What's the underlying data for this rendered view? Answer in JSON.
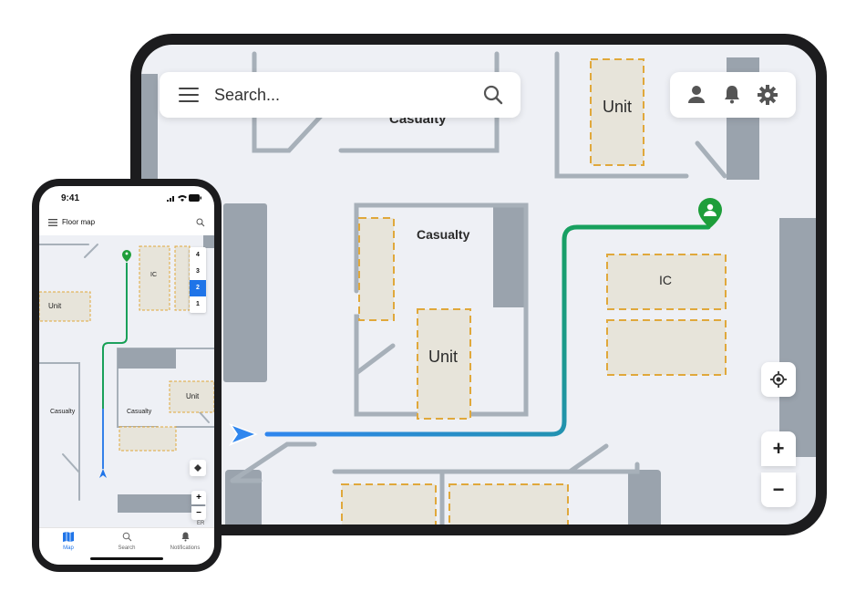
{
  "tablet": {
    "search": {
      "placeholder": "Search..."
    },
    "rooms": {
      "unit_top": "Unit",
      "casualty_top": "Casualty",
      "casualty_center": "Casualty",
      "unit_center": "Unit",
      "ic": "IC"
    },
    "icons": {
      "menu": "hamburger-menu-icon",
      "search": "search-icon",
      "profile": "user-icon",
      "notifications": "bell-icon",
      "settings": "gear-icon",
      "locate": "locate-icon",
      "position": "navigation-arrow-icon",
      "destination": "location-pin-icon"
    },
    "zoom": {
      "in_label": "+",
      "out_label": "−"
    },
    "colors": {
      "route_start": "#2f86ee",
      "route_end": "#16a34a",
      "room_border": "#e0a83b",
      "wall": "#9aa3ad",
      "pin": "#1e9e3a"
    }
  },
  "phone": {
    "status": {
      "time": "9:41"
    },
    "appbar": {
      "title": "Floor map"
    },
    "floors": [
      "4",
      "3",
      "2",
      "1"
    ],
    "active_floor": "2",
    "rooms": {
      "ic": "IC",
      "unit_left": "Unit",
      "casualty_left": "Casualty",
      "casualty_center": "Casualty",
      "unit_right": "Unit",
      "er": "ER"
    },
    "zoom": {
      "in_label": "+",
      "out_label": "−"
    },
    "tabs": [
      {
        "label": "Map",
        "icon": "map-icon",
        "active": true
      },
      {
        "label": "Search",
        "icon": "search-icon",
        "active": false
      },
      {
        "label": "Notifications",
        "icon": "bell-icon",
        "active": false
      }
    ],
    "colors": {
      "active": "#1f74e8"
    }
  }
}
